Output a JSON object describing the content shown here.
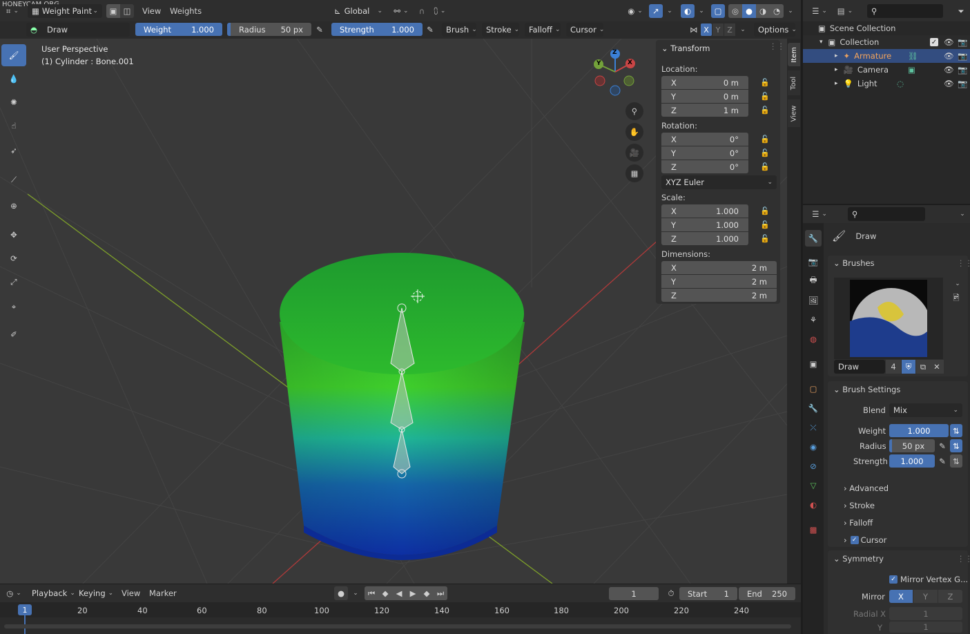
{
  "watermark": "HONEYCAM.ORG",
  "top_header": {
    "mode": "Weight Paint",
    "menus": [
      "View",
      "Weights"
    ],
    "transform_orientation": "Global"
  },
  "tool_header": {
    "brush_name": "Draw",
    "weight_label": "Weight",
    "weight_value": "1.000",
    "radius_label": "Radius",
    "radius_value": "50 px",
    "strength_label": "Strength",
    "strength_value": "1.000",
    "menus": [
      "Brush",
      "Stroke",
      "Falloff",
      "Cursor"
    ],
    "axes": [
      "X",
      "Y",
      "Z"
    ],
    "options": "Options"
  },
  "viewport": {
    "view_name": "User Perspective",
    "object_info": "(1) Cylinder : Bone.001",
    "gizmo_axes": {
      "x": "X",
      "y": "Y",
      "z": "Z"
    }
  },
  "n_panel": {
    "tabs": [
      "Item",
      "Tool",
      "View"
    ],
    "title": "Transform",
    "location_label": "Location:",
    "location": [
      {
        "axis": "X",
        "value": "0 m"
      },
      {
        "axis": "Y",
        "value": "0 m"
      },
      {
        "axis": "Z",
        "value": "1 m"
      }
    ],
    "rotation_label": "Rotation:",
    "rotation": [
      {
        "axis": "X",
        "value": "0°"
      },
      {
        "axis": "Y",
        "value": "0°"
      },
      {
        "axis": "Z",
        "value": "0°"
      }
    ],
    "rotation_mode": "XYZ Euler",
    "scale_label": "Scale:",
    "scale": [
      {
        "axis": "X",
        "value": "1.000"
      },
      {
        "axis": "Y",
        "value": "1.000"
      },
      {
        "axis": "Z",
        "value": "1.000"
      }
    ],
    "dimensions_label": "Dimensions:",
    "dimensions": [
      {
        "axis": "X",
        "value": "2 m"
      },
      {
        "axis": "Y",
        "value": "2 m"
      },
      {
        "axis": "Z",
        "value": "2 m"
      }
    ]
  },
  "outliner": {
    "scene_collection": "Scene Collection",
    "collection": "Collection",
    "items": [
      {
        "name": "Armature"
      },
      {
        "name": "Camera"
      },
      {
        "name": "Light"
      }
    ]
  },
  "properties": {
    "tool_name": "Draw",
    "brushes_title": "Brushes",
    "brush_name": "Draw",
    "brush_users": "4",
    "brush_settings_title": "Brush Settings",
    "blend_label": "Blend",
    "blend_value": "Mix",
    "weight_label": "Weight",
    "weight_value": "1.000",
    "radius_label": "Radius",
    "radius_value": "50 px",
    "strength_label": "Strength",
    "strength_value": "1.000",
    "subpanels": [
      "Advanced",
      "Stroke",
      "Falloff",
      "Cursor"
    ],
    "symmetry_title": "Symmetry",
    "mirror_vertex_groups": "Mirror Vertex G...",
    "mirror_label": "Mirror",
    "mirror_axes": [
      "X",
      "Y",
      "Z"
    ],
    "radial_label": "Radial X",
    "radial_x": "1",
    "radial_y_label": "Y",
    "radial_y": "1"
  },
  "timeline": {
    "menus": [
      "Playback",
      "Keying",
      "View",
      "Marker"
    ],
    "current_frame": "1",
    "start_label": "Start",
    "start_value": "1",
    "end_label": "End",
    "end_value": "250",
    "ruler": [
      "20",
      "40",
      "60",
      "80",
      "100",
      "120",
      "140",
      "160",
      "180",
      "200",
      "220",
      "240"
    ],
    "playhead": "1"
  }
}
